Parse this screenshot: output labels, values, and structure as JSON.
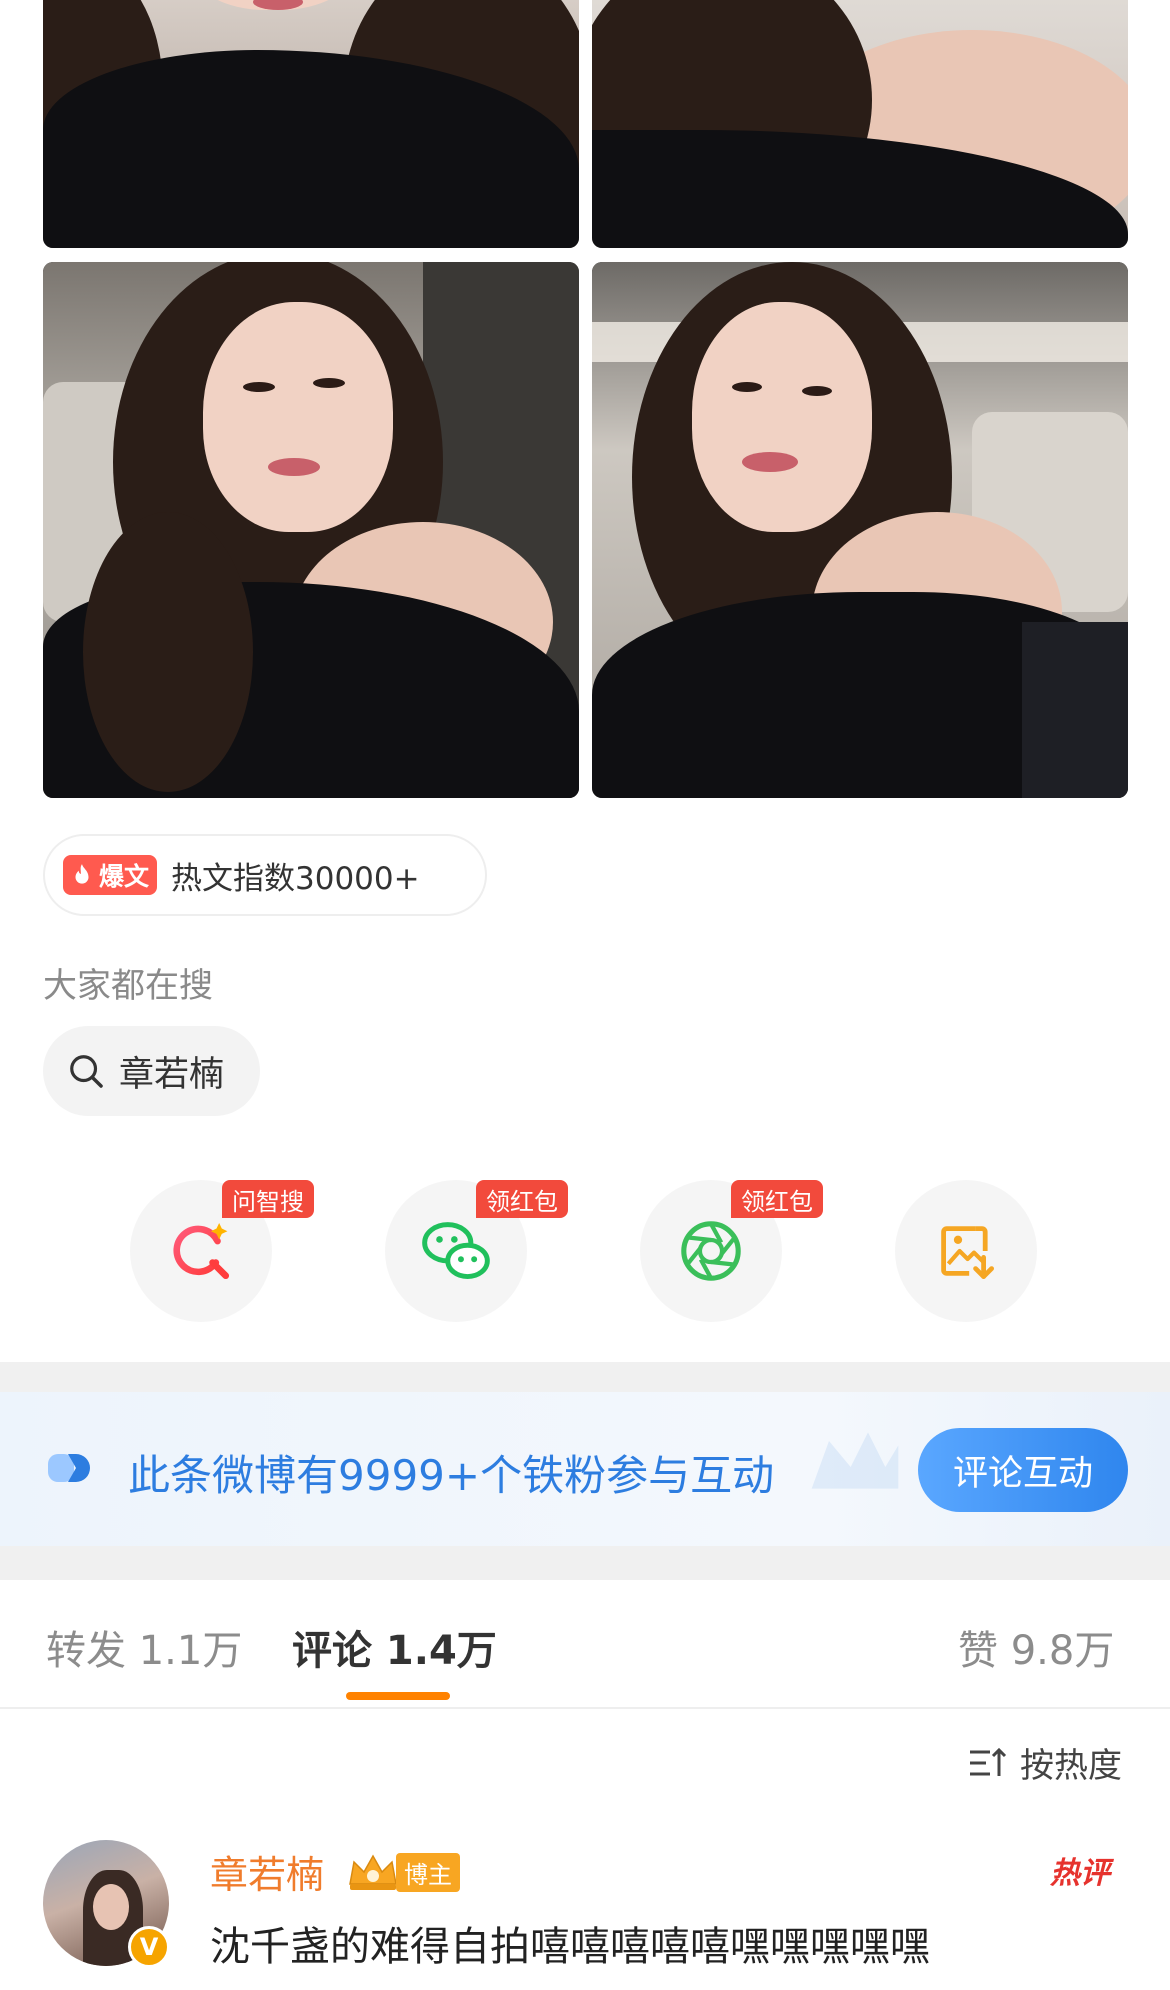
{
  "hot": {
    "badge": "爆文",
    "index_text": "热文指数30000+"
  },
  "search": {
    "hint": "大家都在搜",
    "chip": "章若楠"
  },
  "actions": [
    {
      "icon": "ai-search-icon",
      "badge": "问智搜"
    },
    {
      "icon": "wechat-icon",
      "badge": "领红包"
    },
    {
      "icon": "moments-icon",
      "badge": "领红包"
    },
    {
      "icon": "save-image-icon",
      "badge": ""
    }
  ],
  "fans_banner": {
    "text": "此条微博有9999+个铁粉参与互动",
    "button": "评论互动"
  },
  "tabs": {
    "repost": "转发 1.1万",
    "comment": "评论 1.4万",
    "like": "赞 9.8万"
  },
  "sort": {
    "label": "按热度"
  },
  "comment": {
    "user": "章若楠",
    "role": "博主",
    "hot_label": "热评",
    "verified": "V",
    "text": "沈千盏的难得自拍嘻嘻嘻嘻嘻嘿嘿嘿嘿嘿"
  },
  "colors": {
    "accent": "#ff8200",
    "blue": "#2d7de0",
    "red": "#f24a3c"
  }
}
